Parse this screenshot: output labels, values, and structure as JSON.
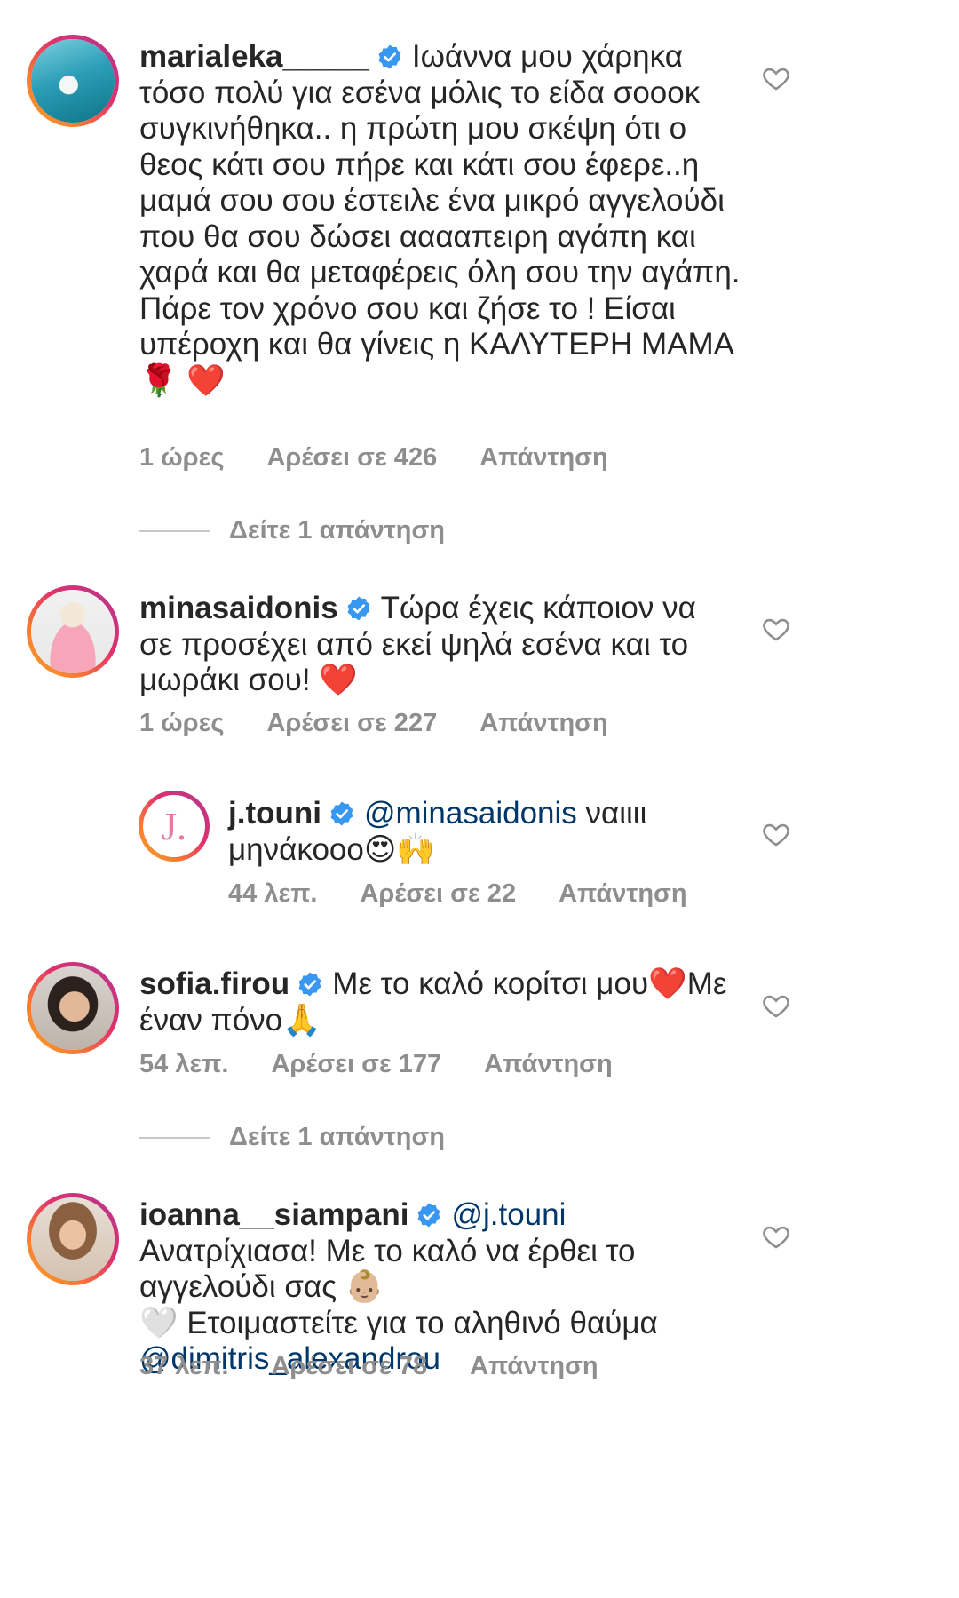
{
  "comments": [
    {
      "username": "marialeka_____",
      "text": "Ιωάννα μου χάρηκα τόσο πολύ για εσένα μόλις το είδα σοοοκ συγκινήθηκα.. η πρώτη μου σκέψη ότι ο θεος κάτι σου πήρε και κάτι σου έφερε..η μαμά σου σου έστειλε ένα μικρό αγγελούδι που θα σου δώσει ααααπειρη αγάπη και χαρά  και θα μεταφέρεις όλη σου την αγάπη.",
      "text2": "Πάρε τον χρόνο σου  και ζήσε το ! Είσαι υπέροχη και θα γίνεις η ΚΑΛΥΤΕΡΗ ΜΑΜΑ",
      "emoji": "🌹 ❤️",
      "time": "1 ώρες",
      "likes": "Αρέσει σε 426",
      "reply": "Απάντηση",
      "view_replies": "Δείτε 1 απάντηση"
    },
    {
      "username": "minasaidonis",
      "text": "Τώρα έχεις κάποιον να σε προσέχει από εκεί ψηλά εσένα και το μωράκι σου!",
      "emoji": "❤️",
      "time": "1 ώρες",
      "likes": "Αρέσει σε 227",
      "reply": "Απάντηση"
    },
    {
      "username": "j.touni",
      "logo_letter": "J.",
      "mention": "@minasaidonis",
      "text": "ναιιιι μηνάκοοο",
      "emoji": "😍🙌",
      "time": "44 λεπ.",
      "likes": "Αρέσει σε 22",
      "reply": "Απάντηση"
    },
    {
      "username": "sofia.firou",
      "text": "Με το καλό κορίτσι μου",
      "emoji": "❤️",
      "text_b": "Με έναν πόνο",
      "emoji_b": "🙏",
      "time": "54 λεπ.",
      "likes": "Αρέσει σε 177",
      "reply": "Απάντηση",
      "view_replies": "Δείτε 1 απάντηση"
    },
    {
      "username": "ioanna__siampani",
      "mention": "@j.touni",
      "text": "Ανατρίχιασα! Με το καλό να έρθει το αγγελούδι σας",
      "emoji": "👶🏼",
      "emoji_b": "🤍",
      "text_b": "Ετοιμαστείτε για το αληθινό θαύμα",
      "mention_b": "@dimitris_alexandrou",
      "time": "37 λεπ.",
      "likes": "Αρέσει σε 78",
      "reply": "Απάντηση"
    }
  ],
  "colors": {
    "verified": "#3897f0",
    "mention": "#00376b",
    "meta": "#8e8e8e"
  },
  "icons": {
    "heart": "heart-outline-icon",
    "verified": "verified-badge-icon"
  }
}
